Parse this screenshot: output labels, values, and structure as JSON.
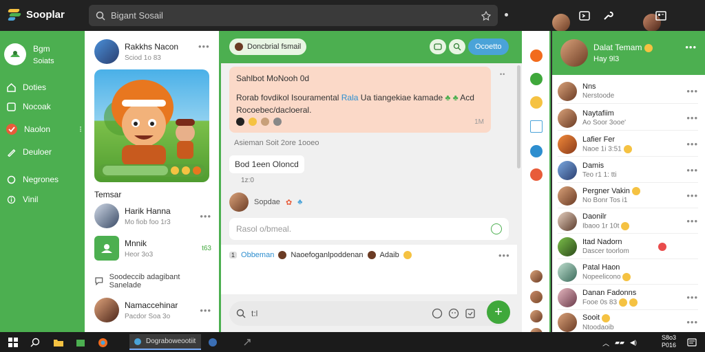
{
  "app": {
    "name": "Sooplar"
  },
  "search": {
    "placeholder": "Bigant Sosail"
  },
  "colors": {
    "brand": "#4caf50",
    "accent": "#4aa3d8",
    "bubble": "#fbd9c8"
  },
  "left_nav": {
    "header_line1": "Bgm",
    "header_line2": "Soiats",
    "items": [
      {
        "label": "Doties",
        "icon": "home-icon"
      },
      {
        "label": "Nocoak",
        "icon": "square-icon"
      },
      {
        "label": "Naolon",
        "icon": "check-icon",
        "active": true,
        "badge": "⁝"
      },
      {
        "label": "Deuloer",
        "icon": "pencil-icon"
      },
      {
        "label": "Negrones",
        "icon": "circle-icon"
      },
      {
        "label": "Vinil",
        "icon": "info-icon"
      }
    ]
  },
  "feed": {
    "profile": {
      "name": "Rakkhs Nacon",
      "sub": "Sciod 1o 83"
    },
    "hero_pill": " ",
    "section_title": "Temsar",
    "rows": [
      {
        "name": "Harik Hanna",
        "sub": "Mo fiob foo 1r3"
      },
      {
        "name": "Mnnik",
        "sub": "Heor 3o3",
        "badge": "t63"
      },
      {
        "name": "Soodeccib adagibant Sanelade",
        "sub": ""
      },
      {
        "name": "Namaccehinar",
        "sub": "Pacdor Soa 3o"
      }
    ]
  },
  "chat": {
    "header_chip": "Doncbrial fsmail",
    "header_pill": "Ocoetto",
    "bubble": {
      "title": "Sahlbot MoNooh 0d",
      "line1_a": "Rorab fovdikol Isouramental ",
      "line1_link": "Rala",
      "line1_b": " Ua tiangekiae kamade",
      "line1_tail": "Acd",
      "line2": "Rocoebec/dacloeral.",
      "time": "1M"
    },
    "meta1": "Asieman Soit 2ore 1ooeo",
    "small_msg": "Bod 1een Oloncd",
    "small_time": "1z:0",
    "sender": "Sopdae",
    "reply_placeholder": "Rasol o/bmeal.",
    "thread": {
      "count": "1",
      "label": "Obbeman",
      "user1": "Naoefoganlpoddenan",
      "user2": "Adaib"
    },
    "compose_placeholder": "t:l"
  },
  "contacts": {
    "me": {
      "name": "Dalat Temam",
      "sub": "Hay 9l3"
    },
    "items": [
      {
        "name": "Nns",
        "sub": "Nerstoode"
      },
      {
        "name": "Naytafiim",
        "sub": "Ao Soor 3ooe'"
      },
      {
        "name": "Lafier Fer",
        "sub": "Naoe 1i 3:51"
      },
      {
        "name": "Damis",
        "sub": "Teo r1 1: tti"
      },
      {
        "name": "Pergner Vakin",
        "sub": "No Bonr Tos i1"
      },
      {
        "name": "Daonilr",
        "sub": "Ibaoo 1r 10t"
      },
      {
        "name": "Itad Nadorn",
        "sub": "Dascer toorlom"
      },
      {
        "name": "Patal Haon",
        "sub": "Nopeelicono"
      },
      {
        "name": "Danan Fadonns",
        "sub": "Fooe 0s 83"
      },
      {
        "name": "Sooit",
        "sub": "Ntoodaoib"
      }
    ]
  },
  "taskbar": {
    "active_app": "Dograboweootiit",
    "tray_line1": "S8o3",
    "tray_line2": "P016"
  }
}
